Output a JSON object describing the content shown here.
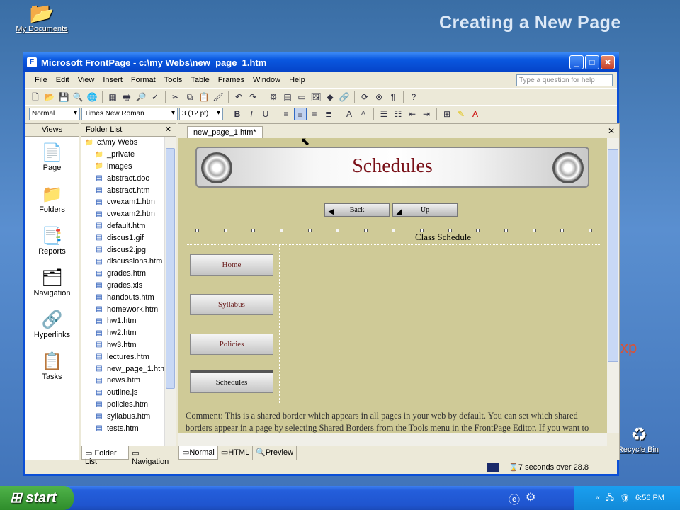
{
  "slide": {
    "title": "Creating a New Page"
  },
  "desktop": {
    "my_documents": "My Documents",
    "recycle_bin": "Recycle Bin"
  },
  "window": {
    "title": "Microsoft FrontPage - c:\\my Webs\\new_page_1.htm",
    "controls": [
      "_",
      "□",
      "✕"
    ]
  },
  "menus": [
    "File",
    "Edit",
    "View",
    "Insert",
    "Format",
    "Tools",
    "Table",
    "Frames",
    "Window",
    "Help"
  ],
  "help_placeholder": "Type a question for help",
  "format_bar": {
    "style": "Normal",
    "font": "Times New Roman",
    "size": "3 (12 pt)"
  },
  "views": {
    "header": "Views",
    "items": [
      "Page",
      "Folders",
      "Reports",
      "Navigation",
      "Hyperlinks",
      "Tasks"
    ],
    "icons": [
      "page-icon",
      "folders-icon",
      "reports-icon",
      "navigation-icon",
      "hyperlinks-icon",
      "tasks-icon"
    ]
  },
  "folder_list": {
    "header": "Folder List",
    "root": "c:\\my Webs",
    "folders": [
      "_private",
      "images"
    ],
    "files": [
      "abstract.doc",
      "abstract.htm",
      "cwexam1.htm",
      "cwexam2.htm",
      "default.htm",
      "discus1.gif",
      "discus2.jpg",
      "discussions.htm",
      "grades.htm",
      "grades.xls",
      "handouts.htm",
      "homework.htm",
      "hw1.htm",
      "hw2.htm",
      "hw3.htm",
      "lectures.htm",
      "new_page_1.htm",
      "news.htm",
      "outline.js",
      "policies.htm",
      "syllabus.htm",
      "tests.htm"
    ]
  },
  "pane_tabs": {
    "folder_list": "Folder List",
    "navigation": "Navigation"
  },
  "editor": {
    "doc_tab": "new_page_1.htm*",
    "banner_title": "Schedules",
    "nav_buttons": [
      "Back",
      "Up"
    ],
    "side_buttons": [
      "Home",
      "Syllabus",
      "Policies",
      "Schedules"
    ],
    "main_text": "Class Schedule",
    "comment": "Comment: This is a shared border which appears in all pages in your web by default. You can set which shared borders appear in a page by selecting Shared Borders from the Tools menu in the FrontPage Editor. If you want to change the settings for your entire web, select Shared Borders from the Tools",
    "view_tabs": [
      "Normal",
      "HTML",
      "Preview"
    ]
  },
  "status": {
    "download_time": "7 seconds over 28.8"
  },
  "taskbar": {
    "start": "start",
    "time": "6:56 PM"
  },
  "colors": {
    "canvas": "#cfca97",
    "banner_text": "#7a1018",
    "titlebar": "#0a58e0"
  }
}
